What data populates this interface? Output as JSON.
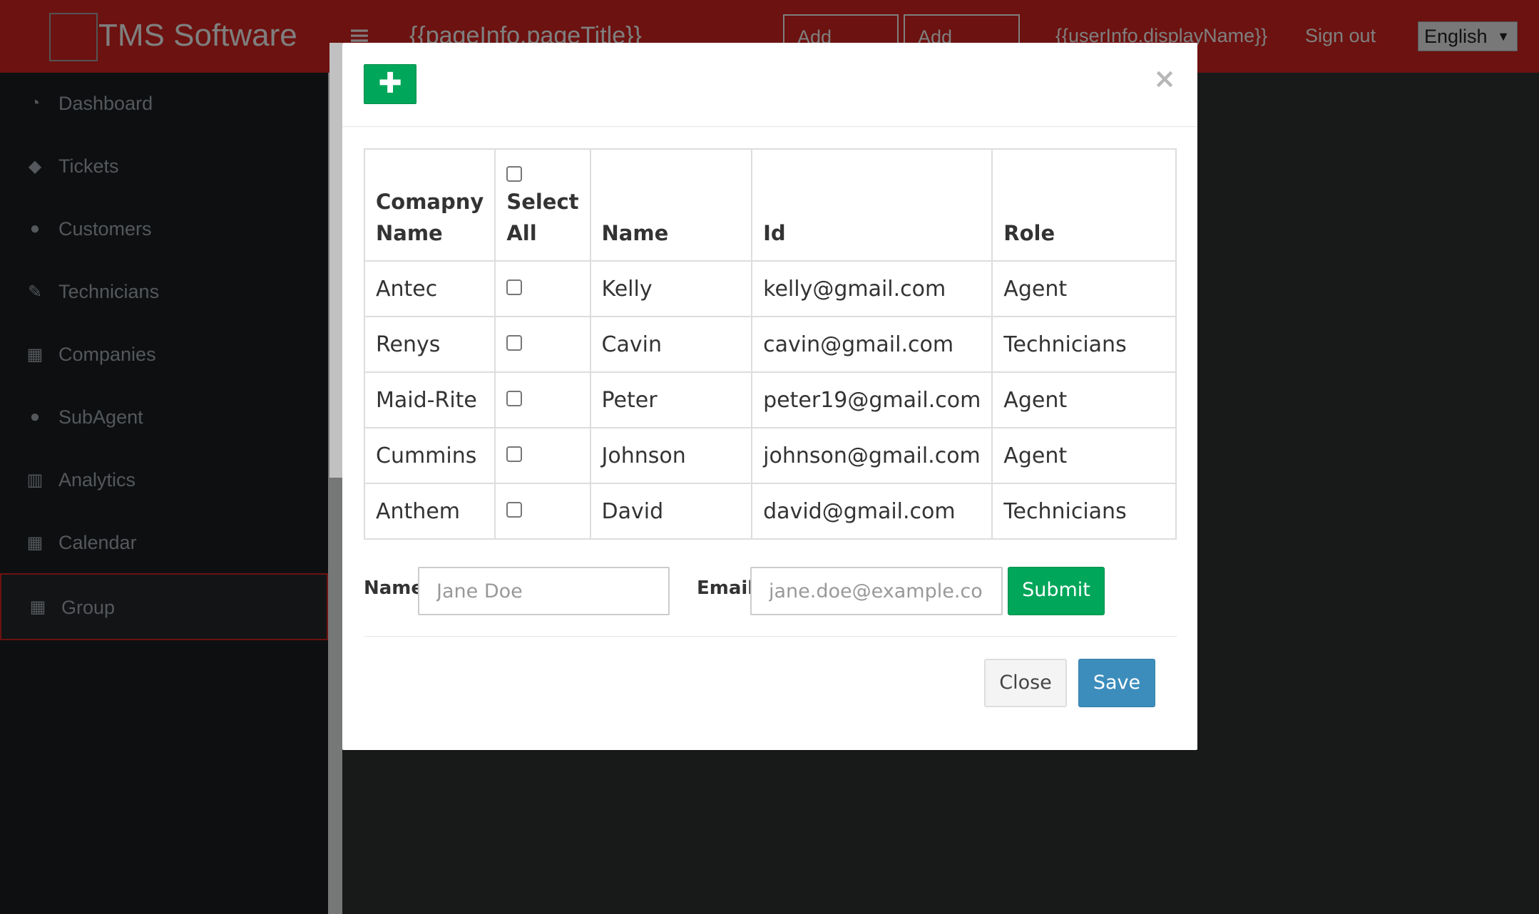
{
  "app": {
    "brand": "TMS Software",
    "page_title": "{{pageInfo.pageTitle}}",
    "header_buttons": [
      "Add Ticket",
      "Add Ticket"
    ],
    "user_name": "{{userInfo.displayName}}",
    "sign_out": "Sign out",
    "language": "English"
  },
  "sidebar": {
    "items": [
      {
        "label": "Dashboard",
        "icon": "dashboard-icon"
      },
      {
        "label": "Tickets",
        "icon": "tag-icon"
      },
      {
        "label": "Customers",
        "icon": "user-icon"
      },
      {
        "label": "Technicians",
        "icon": "wrench-icon"
      },
      {
        "label": "Companies",
        "icon": "calendar-icon"
      },
      {
        "label": "SubAgent",
        "icon": "user-icon"
      },
      {
        "label": "Analytics",
        "icon": "bar-chart-icon"
      },
      {
        "label": "Calendar",
        "icon": "calendar-icon"
      },
      {
        "label": "Group",
        "icon": "calendar-icon",
        "active": true
      }
    ]
  },
  "modal": {
    "add_icon": "plus-icon",
    "close_symbol": "×",
    "table": {
      "headers": {
        "company": "Comapny Name",
        "select_all": "Select All",
        "name": "Name",
        "id": "Id",
        "role": "Role"
      },
      "rows": [
        {
          "company": "Antec",
          "name": "Kelly",
          "id": "kelly@gmail.com",
          "role": "Agent",
          "selected": false
        },
        {
          "company": "Renys",
          "name": "Cavin",
          "id": "cavin@gmail.com",
          "role": "Technicians",
          "selected": false
        },
        {
          "company": "Maid-Rite",
          "name": "Peter",
          "id": "peter19@gmail.com",
          "role": "Agent",
          "selected": false
        },
        {
          "company": "Cummins",
          "name": "Johnson",
          "id": "johnson@gmail.com",
          "role": "Agent",
          "selected": false
        },
        {
          "company": "Anthem",
          "name": "David",
          "id": "david@gmail.com",
          "role": "Technicians",
          "selected": false
        }
      ]
    },
    "form": {
      "name_label": "Name",
      "name_placeholder": "Jane Doe",
      "email_label": "Email",
      "email_placeholder": "jane.doe@example.com",
      "submit_label": "Submit"
    },
    "close_label": "Close",
    "save_label": "Save"
  },
  "colors": {
    "header_red": "#d82520",
    "sidebar_bg": "#1c1e21",
    "success_green": "#00a65a",
    "primary_blue": "#3c8dbc"
  }
}
